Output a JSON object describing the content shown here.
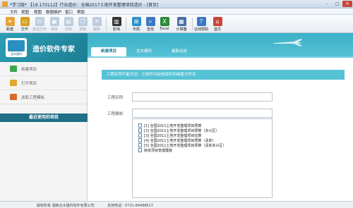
{
  "window": {
    "title": "*学习版* 【19.170112】行业造价：全国2017土地开发整理项目造价 - [首页]",
    "controls": {
      "minimize": "–",
      "maximize": "□",
      "close": "✕"
    }
  },
  "menu": [
    "文件",
    "视图",
    "视图",
    "数据维护",
    "窗口",
    "帮助"
  ],
  "toolbar": [
    {
      "label": "新建",
      "icon": "new-icon",
      "color": "#e8a23a",
      "enabled": true
    },
    {
      "label": "打开",
      "icon": "open-folder-icon",
      "color": "#d9a020",
      "enabled": true
    },
    {
      "label": "现在打开",
      "icon": "recent-icon",
      "color": "#7a9cc0",
      "enabled": false
    },
    {
      "label": "保存",
      "icon": "save-icon",
      "color": "#7a9cc0",
      "enabled": false
    },
    {
      "label": "另存",
      "icon": "save-as-icon",
      "color": "#7a9cc0",
      "enabled": false
    },
    {
      "label": "复制",
      "icon": "copy-icon",
      "color": "#7a9cc0",
      "enabled": false
    },
    {
      "label": "删除",
      "icon": "delete-icon",
      "color": "#7a9cc0",
      "enabled": false
    },
    {
      "label": "影响",
      "icon": "barcode-icon",
      "color": "#333333",
      "enabled": true
    },
    {
      "label": "布局",
      "icon": "layout-icon",
      "color": "#2e8fd0",
      "enabled": true
    },
    {
      "label": "查找",
      "icon": "search-icon",
      "color": "#3a78c2",
      "enabled": true
    },
    {
      "label": "Excel",
      "icon": "excel-icon",
      "color": "#2e8b3d",
      "enabled": true
    },
    {
      "label": "计算器",
      "icon": "calculator-icon",
      "color": "#4a6fa5",
      "enabled": true
    },
    {
      "label": "在线帮助",
      "icon": "help-icon",
      "color": "#3a78c2",
      "enabled": true
    },
    {
      "label": "首页",
      "icon": "home-icon",
      "color": "#c9453a",
      "enabled": true
    }
  ],
  "sidebar": {
    "brand": "造价软件专家",
    "logo_text": "北木建科",
    "items": [
      {
        "label": "新建项目",
        "icon": "new-project-icon",
        "color": "#3aa84a"
      },
      {
        "label": "打开项目",
        "icon": "open-project-icon",
        "color": "#e2a62b"
      },
      {
        "label": "选取工程模板",
        "icon": "template-icon",
        "color": "#d76a2a"
      }
    ],
    "recent_header": "最近使用的项目"
  },
  "tabs": [
    {
      "label": "新建项目",
      "active": true
    },
    {
      "label": "北木建科",
      "active": false
    },
    {
      "label": "最新动态",
      "active": false
    }
  ],
  "form": {
    "hint": "工程名称不能为空。它将作为缺省保存的磁盘文件名",
    "name_label": "工程名称",
    "code_label": "工程编制",
    "name_value": "",
    "code_value": ""
  },
  "templates": [
    "[1] 全国2011土地开发整理项目预算",
    "[2] 全国2011土地开发整理项目预算（多兴区）",
    "[3] 全国2011土地开发整理项目估算",
    "[4] 全国2011土地开发整理项目预算（清单）",
    "[5] 全国2011土地开发整理项目预算（清单多兴区）",
    "缺省项目管理模板"
  ],
  "status": {
    "copyright": "版权所有 湖南北木建科软件有限公司",
    "phone": "支持电话：0731-84488617"
  }
}
